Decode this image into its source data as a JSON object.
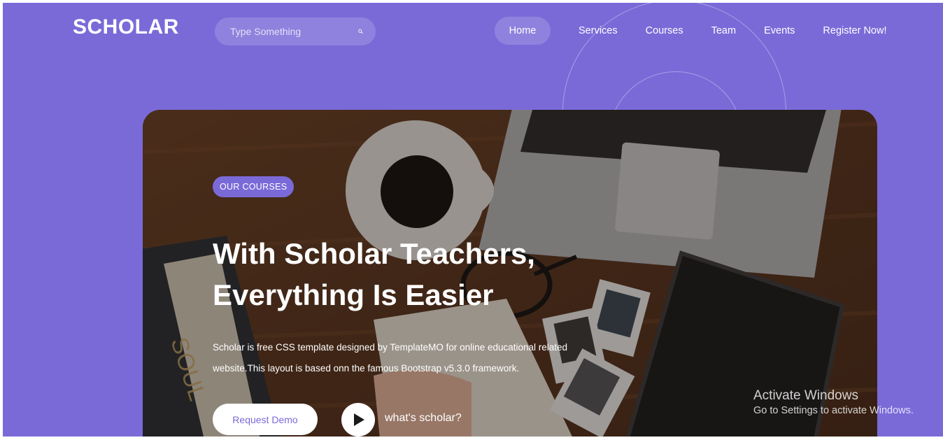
{
  "header": {
    "logo": "SCHOLAR",
    "search": {
      "placeholder": "Type Something",
      "icon": "search-icon"
    },
    "nav": [
      {
        "label": "Home",
        "active": true
      },
      {
        "label": "Services",
        "active": false
      },
      {
        "label": "Courses",
        "active": false
      },
      {
        "label": "Team",
        "active": false
      },
      {
        "label": "Events",
        "active": false
      },
      {
        "label": "Register Now!",
        "active": false
      }
    ]
  },
  "hero": {
    "badge": "OUR COURSES",
    "title_line1": "With Scholar Teachers,",
    "title_line2": "Everything Is Easier",
    "description_line1": "Scholar is free CSS template designed by TemplateMO for online educational related",
    "description_line2": "website.This layout is based onn the famous Bootstrap v5.3.0 framework.",
    "demo_button": "Request Demo",
    "play_icon": "play-icon",
    "play_label": "what's scholar?"
  },
  "watermark": {
    "title": "Activate Windows",
    "subtitle": "Go to Settings to activate Windows."
  },
  "colors": {
    "accent": "#7a6ad8",
    "text_light": "#ffffff"
  }
}
